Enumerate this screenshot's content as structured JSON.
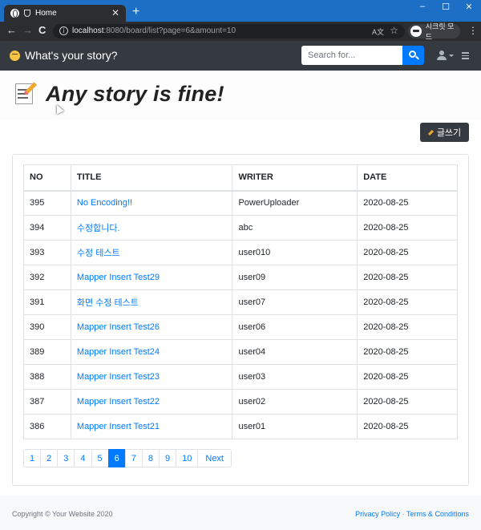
{
  "browser": {
    "tab_title": "Home",
    "new_tab": "+",
    "url_host": "localhost",
    "url_path": ":8080/board/list?page=6&amount=10",
    "incognito_label": "시크릿 모드",
    "win_min": "–",
    "win_max": "☐",
    "win_close": "✕",
    "tab_close": "✕",
    "back": "←",
    "forward": "→",
    "reload": "C",
    "info": "i",
    "translate": "A文",
    "bookmark": "☆",
    "menu": "⋮"
  },
  "navbar": {
    "brand": "What's your story?",
    "search_placeholder": "Search for..."
  },
  "hero": {
    "heading": "Any story is fine!"
  },
  "actions": {
    "write_label": "글쓰기"
  },
  "table": {
    "headers": [
      "NO",
      "TITLE",
      "WRITER",
      "DATE"
    ],
    "rows": [
      {
        "no": "395",
        "title": "No Encoding!!",
        "writer": "PowerUploader",
        "date": "2020-08-25"
      },
      {
        "no": "394",
        "title": "수정합니다.",
        "writer": "abc",
        "date": "2020-08-25"
      },
      {
        "no": "393",
        "title": "수정 테스트",
        "writer": "user010",
        "date": "2020-08-25"
      },
      {
        "no": "392",
        "title": "Mapper Insert Test29",
        "writer": "user09",
        "date": "2020-08-25"
      },
      {
        "no": "391",
        "title": "화면 수정 테스트",
        "writer": "user07",
        "date": "2020-08-25"
      },
      {
        "no": "390",
        "title": "Mapper Insert Test26",
        "writer": "user06",
        "date": "2020-08-25"
      },
      {
        "no": "389",
        "title": "Mapper Insert Test24",
        "writer": "user04",
        "date": "2020-08-25"
      },
      {
        "no": "388",
        "title": "Mapper Insert Test23",
        "writer": "user03",
        "date": "2020-08-25"
      },
      {
        "no": "387",
        "title": "Mapper Insert Test22",
        "writer": "user02",
        "date": "2020-08-25"
      },
      {
        "no": "386",
        "title": "Mapper Insert Test21",
        "writer": "user01",
        "date": "2020-08-25"
      }
    ]
  },
  "pagination": {
    "pages": [
      "1",
      "2",
      "3",
      "4",
      "5",
      "6",
      "7",
      "8",
      "9",
      "10"
    ],
    "active": "6",
    "next": "Next"
  },
  "footer": {
    "copyright": "Copyright © Your Website 2020",
    "privacy": "Privacy Policy",
    "separator": " · ",
    "terms": "Terms & Conditions"
  }
}
